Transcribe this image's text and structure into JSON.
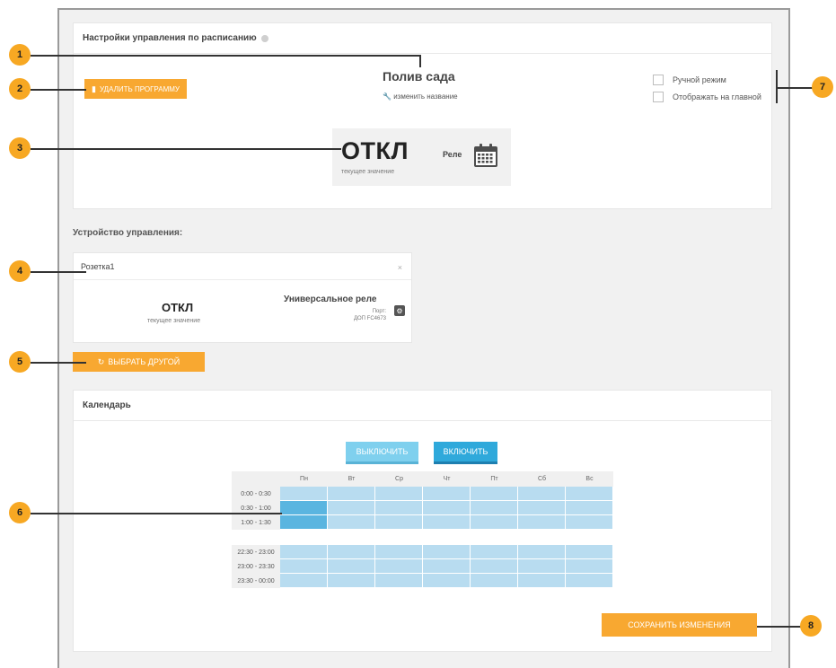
{
  "schedule_panel": {
    "title": "Настройки управления по расписанию",
    "delete_label": "УДАЛИТЬ ПРОГРАММУ",
    "program_title": "Полив сада",
    "rename_label": "изменить название",
    "manual_mode_label": "Ручной режим",
    "show_on_main_label": "Отображать на главной",
    "current_value": "ОТКЛ",
    "current_value_caption": "текущее значение",
    "relay_label": "Реле"
  },
  "device": {
    "section_title": "Устройство управления:",
    "name": "Розетка1",
    "close_glyph": "×",
    "value": "ОТКЛ",
    "value_caption": "текущее значение",
    "type": "Универсальное реле",
    "port_label": "Порт:",
    "port_value": "ДОП FC4673",
    "choose_other_label": "ВЫБРАТЬ ДРУГОЙ"
  },
  "calendar": {
    "title": "Календарь",
    "off_button": "ВЫКЛЮЧИТЬ",
    "on_button": "ВКЛЮЧИТЬ",
    "days": [
      "Пн",
      "Вт",
      "Ср",
      "Чт",
      "Пт",
      "Сб",
      "Вс"
    ],
    "rows": [
      {
        "time": "0:00 - 0:30",
        "active": [
          false,
          false,
          false,
          false,
          false,
          false,
          false
        ]
      },
      {
        "time": "0:30 - 1:00",
        "active": [
          true,
          false,
          false,
          false,
          false,
          false,
          false
        ]
      },
      {
        "time": "1:00 - 1:30",
        "active": [
          true,
          false,
          false,
          false,
          false,
          false,
          false
        ]
      },
      {
        "time": "22:30 - 23:00",
        "active": [
          false,
          false,
          false,
          false,
          false,
          false,
          false
        ]
      },
      {
        "time": "23:00 - 23:30",
        "active": [
          false,
          false,
          false,
          false,
          false,
          false,
          false
        ]
      },
      {
        "time": "23:30 - 00:00",
        "active": [
          false,
          false,
          false,
          false,
          false,
          false,
          false
        ]
      }
    ],
    "save_label": "СОХРАНИТЬ ИЗМЕНЕНИЯ"
  },
  "callouts": [
    "1",
    "2",
    "3",
    "4",
    "5",
    "6",
    "7",
    "8"
  ],
  "colors": {
    "accent_orange": "#f8a831",
    "cell_off": "#b8dcf0",
    "cell_on": "#5ab5e0",
    "button_on": "#2fa9db"
  }
}
